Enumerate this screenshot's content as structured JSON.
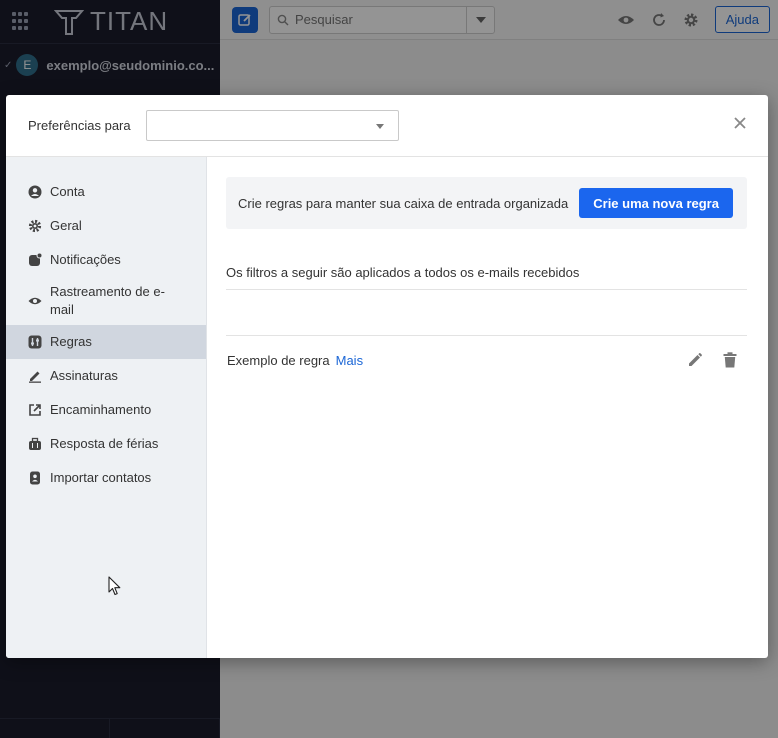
{
  "app": {
    "brand": "TITAN",
    "account_initial": "E",
    "account_email": "exemplo@seudominio.co...",
    "search_placeholder": "Pesquisar",
    "help_label": "Ajuda"
  },
  "modal": {
    "preferences_label": "Preferências para",
    "selected_account": "",
    "close_icon": "close-icon"
  },
  "nav": {
    "items": [
      {
        "label": "Conta",
        "icon": "user-circle-icon"
      },
      {
        "label": "Geral",
        "icon": "gear-icon"
      },
      {
        "label": "Notificações",
        "icon": "notification-icon"
      },
      {
        "label": "Rastreamento de e-mail",
        "icon": "eye-icon"
      },
      {
        "label": "Regras",
        "icon": "filter-rules-icon",
        "active": true
      },
      {
        "label": "Assinaturas",
        "icon": "pen-icon"
      },
      {
        "label": "Encaminhamento",
        "icon": "forward-icon"
      },
      {
        "label": "Resposta de férias",
        "icon": "suitcase-icon"
      },
      {
        "label": "Importar contatos",
        "icon": "contact-icon"
      }
    ]
  },
  "rules": {
    "promo_text": "Crie regras para manter sua caixa de entrada organizada",
    "new_rule_label": "Crie uma nova regra",
    "filters_heading": "Os filtros a seguir são aplicados a todos os e-mails recebidos",
    "items": [
      {
        "name": "Exemplo de regra",
        "more_label": "Mais"
      }
    ]
  },
  "colors": {
    "accent": "#1b66ee",
    "sidebar_bg": "#1a1d2b",
    "nav_bg": "#eef1f4",
    "nav_active": "#d0d6df"
  }
}
